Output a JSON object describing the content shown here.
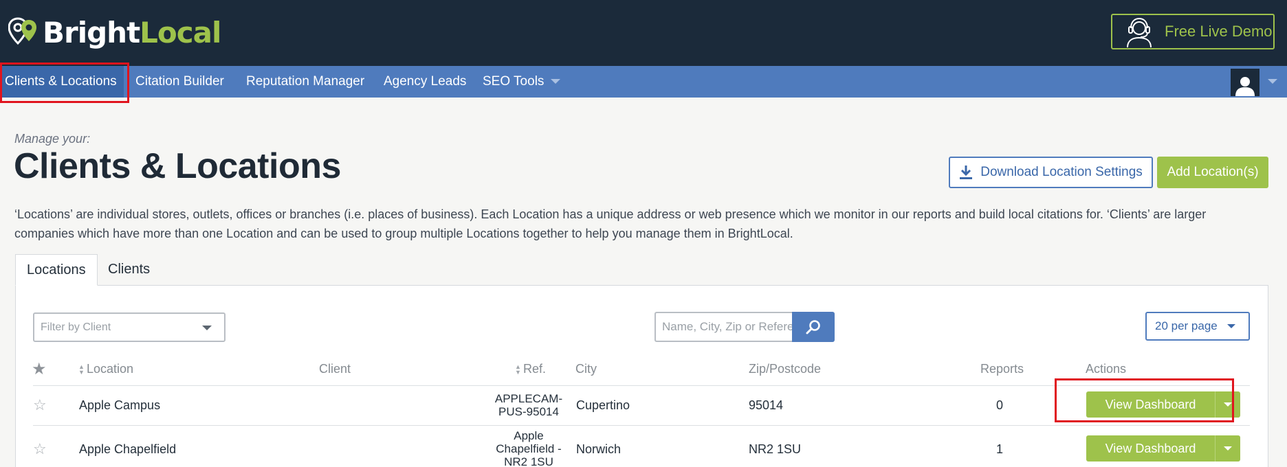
{
  "header": {
    "logo_bright": "Bright",
    "logo_local": "Local",
    "demo_label": "Free Live Demo"
  },
  "nav": {
    "items": [
      {
        "label": "Clients & Locations"
      },
      {
        "label": "Citation Builder"
      },
      {
        "label": "Reputation Manager"
      },
      {
        "label": "Agency Leads"
      },
      {
        "label": "SEO Tools"
      }
    ]
  },
  "page": {
    "subtitle": "Manage your:",
    "title": "Clients & Locations",
    "download_label": "Download Location Settings",
    "add_label": "Add Location(s)",
    "description": "‘Locations’ are individual stores, outlets, offices or branches (i.e. places of business). Each Location has a unique address or web presence which we monitor in our reports and build local citations for. ‘Clients’ are larger companies which have more than one Location and can be used to group multiple Locations together to help you manage them in BrightLocal."
  },
  "tabs": [
    {
      "label": "Locations"
    },
    {
      "label": "Clients"
    }
  ],
  "filters": {
    "client_placeholder": "Filter by Client",
    "search_placeholder": "Name, City, Zip or Reference",
    "per_page": "20 per page"
  },
  "table": {
    "headers": {
      "location": "Location",
      "client": "Client",
      "ref": "Ref.",
      "city": "City",
      "zip": "Zip/Postcode",
      "reports": "Reports",
      "actions": "Actions"
    },
    "rows": [
      {
        "location": "Apple Campus",
        "client": "",
        "ref_line1": "APPLECAM-",
        "ref_line2": "PUS-95014",
        "ref_line3": "",
        "city": "Cupertino",
        "zip": "95014",
        "reports": "0",
        "action": "View Dashboard"
      },
      {
        "location": "Apple Chapelfield",
        "client": "",
        "ref_line1": "Apple",
        "ref_line2": "Chapelfield -",
        "ref_line3": "NR2 1SU",
        "city": "Norwich",
        "zip": "NR2 1SU",
        "reports": "1",
        "action": "View Dashboard"
      }
    ]
  },
  "colors": {
    "header_bg": "#1b2a3a",
    "nav_bg": "#4f7bbd",
    "accent_green": "#9ec24b",
    "highlight_red": "#e0141e"
  }
}
